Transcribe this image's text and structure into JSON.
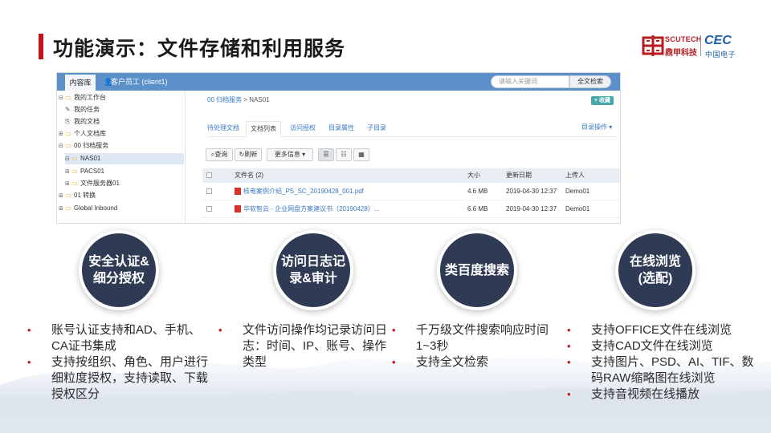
{
  "slide": {
    "title": "功能演示：文件存储和利用服务",
    "accent_color": "#c0131b"
  },
  "logo": {
    "scutech_en": "SCUTECH",
    "scutech_cn": "鼎甲科技",
    "cec_en": "CEC",
    "cec_cn": "中国电子"
  },
  "app": {
    "topbar": {
      "repo_tab": "内容库",
      "user_label": "客户员工 (client1)",
      "search_placeholder": "请输入关键词",
      "search_button": "全文检索",
      "color": "#5b90c8"
    },
    "tree": [
      {
        "label": "我的工作台",
        "toggle": "⊟",
        "icon": "folder"
      },
      {
        "label": "我的任务",
        "toggle": "",
        "icon": "edit"
      },
      {
        "label": "我的文档",
        "toggle": "",
        "icon": "doc"
      },
      {
        "label": "个人文档库",
        "toggle": "⊞",
        "icon": "folder"
      },
      {
        "label": "00 归档服务",
        "toggle": "⊟",
        "icon": "folder"
      },
      {
        "label": "NAS01",
        "toggle": "⊟",
        "icon": "folder",
        "selected": true
      },
      {
        "label": "PACS01",
        "toggle": "⊞",
        "icon": "folder"
      },
      {
        "label": "文件服务器01",
        "toggle": "⊞",
        "icon": "folder"
      },
      {
        "label": "01 转换",
        "toggle": "⊞",
        "icon": "folder"
      },
      {
        "label": "Global Inbound",
        "toggle": "⊞",
        "icon": "folder"
      }
    ],
    "breadcrumb": {
      "root": "00 归档服务",
      "sep": ">",
      "current": "NAS01"
    },
    "favorite_button": "+ 收藏",
    "tabs": [
      "待处理文档",
      "文档列表",
      "访问授权",
      "目录属性",
      "子目录"
    ],
    "active_tab_index": 1,
    "directory_ops": "目录操作 ▾",
    "toolbar": {
      "query": "查询",
      "refresh": "刷新",
      "more_info": "更多信息"
    },
    "grid": {
      "columns": [
        "文件名 (2)",
        "大小",
        "更新日期",
        "上传人"
      ],
      "rows": [
        {
          "name": "核电案例介绍_PS_SC_20190428_001.pdf",
          "size": "4.6 MB",
          "date": "2019-04-30 12:37",
          "uploader": "Demo01"
        },
        {
          "name": "华软智云 - 企业网盘方案建议书（20190428）...",
          "size": "6.6 MB",
          "date": "2019-04-30 12:37",
          "uploader": "Demo01"
        }
      ]
    }
  },
  "features": [
    {
      "title": "安全认证&细分授权",
      "bullets": [
        "账号认证支持和AD、手机、CA证书集成",
        "支持按组织、角色、用户进行细粒度授权，支持读取、下载授权区分"
      ]
    },
    {
      "title": "访问日志记录&审计",
      "bullets": [
        "文件访问操作均记录访问日志：时间、IP、账号、操作类型"
      ]
    },
    {
      "title": "类百度搜索",
      "bullets": [
        "千万级文件搜索响应时间1~3秒",
        "支持全文检索"
      ]
    },
    {
      "title": "在线浏览(选配)",
      "bullets": [
        "支持OFFICE文件在线浏览",
        "支持CAD文件在线浏览",
        "支持图片、PSD、AI、TIF、数码RAW缩略图在线浏览",
        "支持音视频在线播放"
      ]
    }
  ]
}
